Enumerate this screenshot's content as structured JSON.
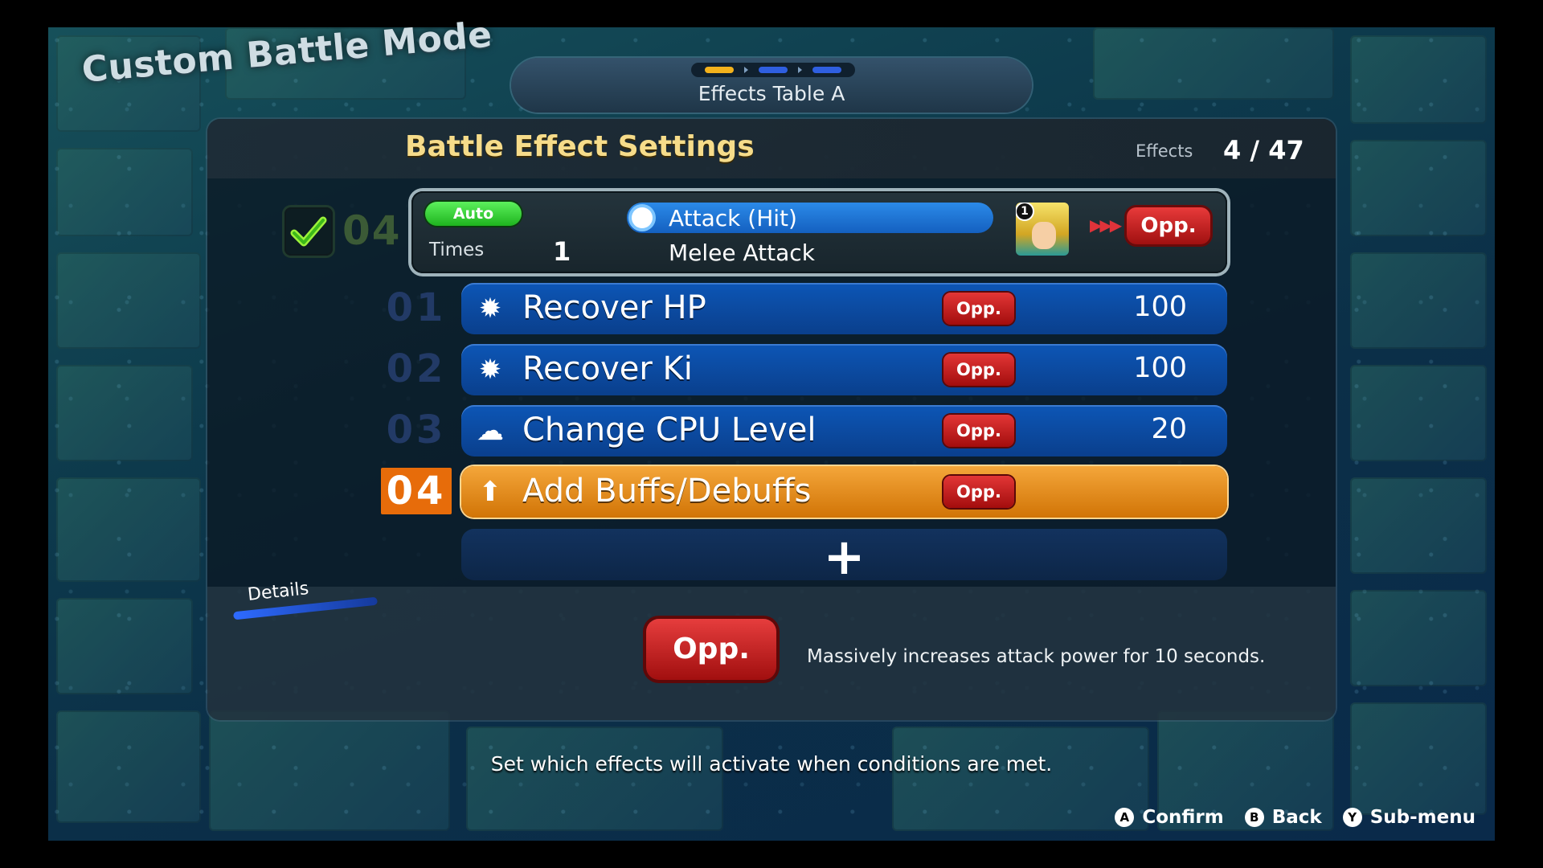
{
  "mode_title": "Custom Battle Mode",
  "table_tab": {
    "label": "Effects Table A"
  },
  "panel": {
    "title": "Battle Effect Settings",
    "effects_label": "Effects",
    "effects_count": "4 / 47"
  },
  "condition": {
    "number": "04",
    "auto_label": "Auto",
    "times_label": "Times",
    "times_value": "1",
    "trigger": "Attack (Hit)",
    "subtype": "Melee Attack",
    "portrait_badge": "1",
    "target_arrows": "▶▶▶",
    "target": "Opp."
  },
  "effects": [
    {
      "num": "01",
      "icon": "gear-icon",
      "glyph": "✹",
      "label": "Recover HP",
      "target": "Opp.",
      "value": "100"
    },
    {
      "num": "02",
      "icon": "gear-icon",
      "glyph": "✹",
      "label": "Recover Ki",
      "target": "Opp.",
      "value": "100"
    },
    {
      "num": "03",
      "icon": "cloud-icon",
      "glyph": "☁",
      "label": "Change CPU Level",
      "target": "Opp.",
      "value": "20"
    },
    {
      "num": "04",
      "icon": "up-arrow-icon",
      "glyph": "⬆",
      "label": "Add Buffs/Debuffs",
      "target": "Opp.",
      "value": ""
    }
  ],
  "add_row": {
    "glyph": "+"
  },
  "details": {
    "tab_label": "Details",
    "target": "Opp.",
    "description": "Massively increases attack power for 10 seconds."
  },
  "help_text": "Set which effects will activate when conditions are met.",
  "controls": {
    "confirm_btn": "A",
    "confirm": "Confirm",
    "back_btn": "B",
    "back": "Back",
    "submenu_btn": "Y",
    "submenu": "Sub-menu"
  },
  "colors": {
    "accent_gold": "#f6dc8a",
    "row_blue": "#0d56b6",
    "row_selected": "#f4a63a",
    "opp_red": "#e33636",
    "auto_green": "#34d234"
  }
}
